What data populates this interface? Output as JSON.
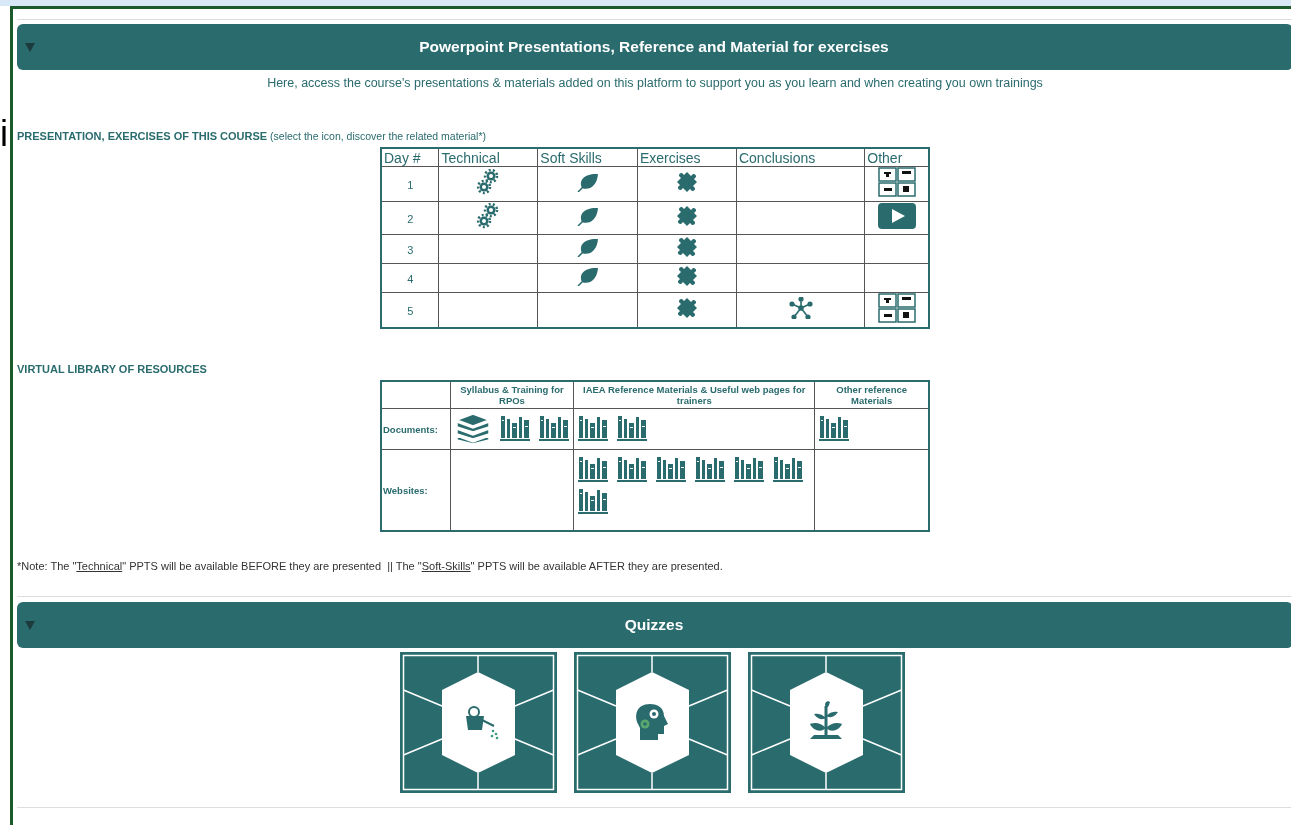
{
  "background_page": {
    "fragments": [
      {
        "text": "i"
      }
    ]
  },
  "materials_panel": {
    "title": "Powerpoint Presentations, Reference and Material for exercises",
    "expanded": true,
    "intro": "Here, access the course's presentations & materials added on this platform to support you as you learn and when creating you own trainings",
    "course_heading": "**PRESENTATION, EXERCISES OF THIS COURSE** (select the icon, discover the related material*)",
    "course_table": {
      "columns": [
        "Day #",
        "Technical",
        "Soft Skills",
        "Exercises",
        "Conclusions",
        "Other"
      ],
      "rows": [
        {
          "day": "1",
          "cells": [
            {
              "kind": "icon"
            },
            {
              "kind": "icon"
            },
            {
              "kind": "icon"
            },
            {
              "kind": "empty"
            },
            {
              "kind": "media-grid"
            }
          ]
        },
        {
          "day": "2",
          "cells": [
            {
              "kind": "icon"
            },
            {
              "kind": "icon"
            },
            {
              "kind": "icon"
            },
            {
              "kind": "empty"
            },
            {
              "kind": "video"
            }
          ]
        },
        {
          "day": "3",
          "cells": [
            {
              "kind": "empty"
            },
            {
              "kind": "icon"
            },
            {
              "kind": "icon"
            },
            {
              "kind": "empty"
            },
            {
              "kind": "empty"
            }
          ]
        },
        {
          "day": "4",
          "cells": [
            {
              "kind": "empty"
            },
            {
              "kind": "icon"
            },
            {
              "kind": "icon"
            },
            {
              "kind": "empty"
            },
            {
              "kind": "empty"
            }
          ]
        },
        {
          "day": "5",
          "cells": [
            {
              "kind": "empty"
            },
            {
              "kind": "empty"
            },
            {
              "kind": "icon"
            },
            {
              "kind": "icon"
            },
            {
              "kind": "media-grid"
            }
          ]
        }
      ]
    },
    "library_heading": "VIRTUAL LIBRARY OF RESOURCES",
    "library_table": {
      "columns": [
        "Syllabus & Training for RPOs",
        "IAEA Reference Materials & Useful web pages for trainers",
        "Other reference Materials"
      ],
      "rows": [
        {
          "label": "Documents:",
          "cells": [
            {
              "links": [
                {
                  "kind": "books"
                },
                {
                  "kind": "shelf"
                },
                {
                  "kind": "shelf"
                }
              ]
            },
            {
              "links": [
                {
                  "kind": "shelf"
                },
                {
                  "kind": "shelf"
                }
              ]
            },
            {
              "links": [
                {
                  "kind": "shelf"
                }
              ]
            }
          ]
        },
        {
          "label": "Websites:",
          "cells": [
            {},
            {
              "links": [
                {
                  "kind": "shelf"
                },
                {
                  "kind": "shelf"
                },
                {
                  "kind": "shelf"
                },
                {
                  "kind": "shelf"
                },
                {
                  "kind": "shelf"
                },
                {
                  "kind": "shelf"
                },
                {
                  "kind": "shelf"
                }
              ]
            },
            {}
          ]
        }
      ]
    },
    "note": [
      {
        "kind": "text",
        "text": "*Note: The \""
      },
      {
        "kind": "link",
        "text": "Technical"
      },
      {
        "kind": "text",
        "text": "\" PPTS will be available BEFORE they are presented  || The \""
      },
      {
        "kind": "link",
        "text": "Soft-Skills"
      },
      {
        "kind": "text",
        "text": "\" PPTS will be available AFTER they are presented."
      }
    ]
  },
  "quizzes_panel": {
    "title": "Quizzes",
    "expanded": true,
    "tiles": [
      {
        "kind": "watering-can"
      },
      {
        "kind": "head"
      },
      {
        "kind": "plant"
      }
    ]
  }
}
